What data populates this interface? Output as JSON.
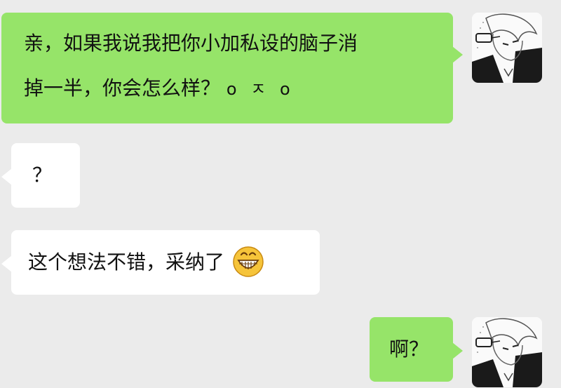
{
  "messages": [
    {
      "direction": "sent",
      "line1": "亲，如果我说我把你小加私设的脑子消",
      "line2": "掉一半，你会怎么样？",
      "kaomoji": "o ㅈ o"
    },
    {
      "direction": "received",
      "text": "？"
    },
    {
      "direction": "received",
      "text": "这个想法不错，采纳了",
      "emoji": "grinning-face-icon"
    },
    {
      "direction": "sent",
      "text": "啊？"
    }
  ],
  "colors": {
    "background": "#ebebeb",
    "sent_bubble": "#96e469",
    "received_bubble": "#ffffff",
    "emoji_face": "#f6c43a"
  }
}
